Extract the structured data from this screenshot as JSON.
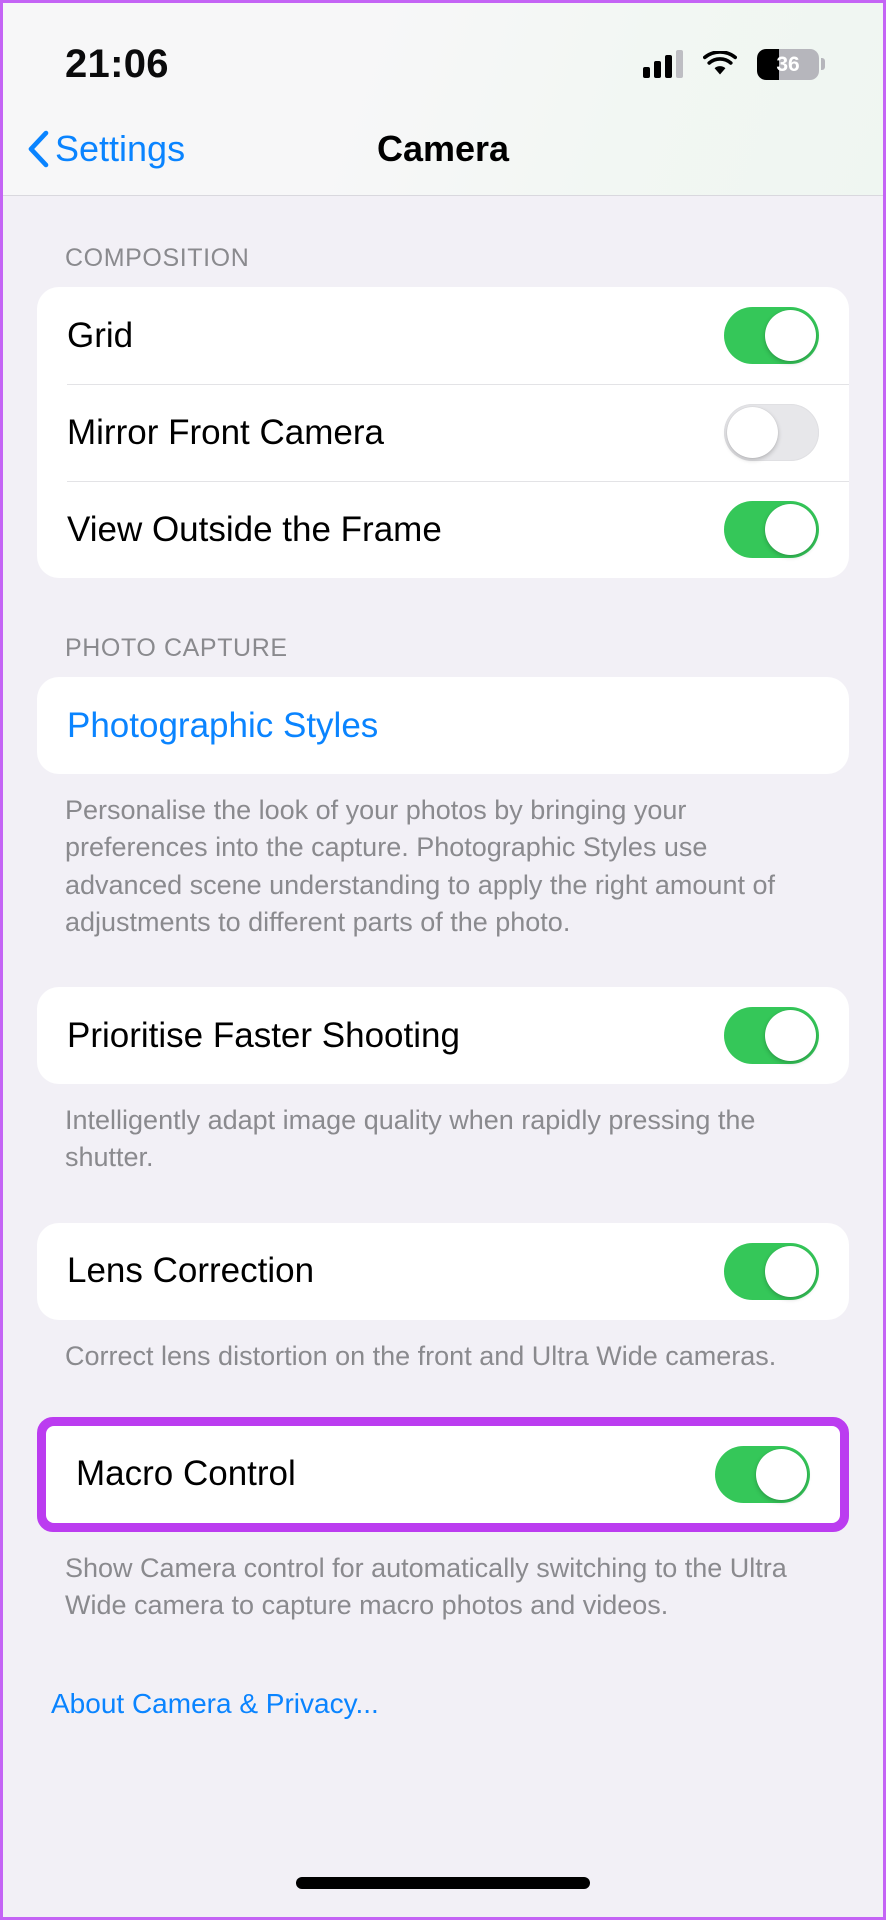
{
  "status_bar": {
    "time": "21:06",
    "cellular_icon": "cellular-bars-icon",
    "wifi_icon": "wifi-icon",
    "battery_icon": "battery-icon",
    "battery_percent": "36",
    "battery_level": 36
  },
  "nav": {
    "back_label": "Settings",
    "back_icon": "chevron-left-icon",
    "title": "Camera"
  },
  "sections": [
    {
      "header": "COMPOSITION",
      "rows": [
        {
          "label": "Grid",
          "control": "toggle",
          "state": "on"
        },
        {
          "label": "Mirror Front Camera",
          "control": "toggle",
          "state": "off"
        },
        {
          "label": "View Outside the Frame",
          "control": "toggle",
          "state": "on"
        }
      ]
    },
    {
      "header": "PHOTO CAPTURE",
      "rows": [
        {
          "label": "Photographic Styles",
          "control": "link"
        }
      ],
      "footnote": "Personalise the look of your photos by bringing your preferences into the capture. Photographic Styles use advanced scene understanding to apply the right amount of adjustments to different parts of the photo."
    }
  ],
  "prioritise": {
    "label": "Prioritise Faster Shooting",
    "state": "on",
    "footnote": "Intelligently adapt image quality when rapidly pressing the shutter."
  },
  "lens_correction": {
    "label": "Lens Correction",
    "state": "on",
    "footnote": "Correct lens distortion on the front and Ultra Wide cameras."
  },
  "macro_control": {
    "label": "Macro Control",
    "state": "on",
    "highlighted": true,
    "footnote": "Show Camera control for automatically switching to the Ultra Wide camera to capture macro photos and videos."
  },
  "about_link": "About Camera & Privacy...",
  "colors": {
    "accent_blue": "#0A84FF",
    "toggle_on_green": "#35C759",
    "toggle_off_grey": "#E7E7EA",
    "highlight_purple": "#BB3CF0",
    "page_background": "#F2F0F6",
    "secondary_text": "#8A8A8E"
  }
}
